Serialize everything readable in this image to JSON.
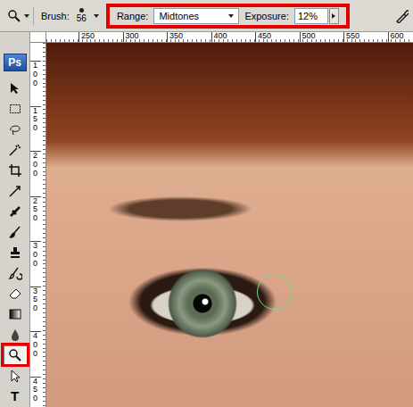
{
  "app_logo": "Ps",
  "options_bar": {
    "brush_label": "Brush:",
    "brush_size": "56",
    "range_label": "Range:",
    "range_value": "Midtones",
    "exposure_label": "Exposure:",
    "exposure_value": "12%",
    "highlighted": true
  },
  "tools": [
    {
      "selected": false,
      "highlighted": false
    },
    {
      "selected": false,
      "highlighted": false
    },
    {
      "selected": false,
      "highlighted": false
    },
    {
      "selected": false,
      "highlighted": false
    },
    {
      "selected": false,
      "highlighted": false
    },
    {
      "selected": false,
      "highlighted": false
    },
    {
      "selected": false,
      "highlighted": false
    },
    {
      "selected": false,
      "highlighted": false
    },
    {
      "selected": false,
      "highlighted": false
    },
    {
      "selected": false,
      "highlighted": false
    },
    {
      "selected": false,
      "highlighted": false
    },
    {
      "selected": false,
      "highlighted": false
    },
    {
      "selected": false,
      "highlighted": false
    },
    {
      "selected": true,
      "highlighted": true
    },
    {
      "selected": false,
      "highlighted": false
    },
    {
      "label": "T",
      "selected": false,
      "highlighted": false
    }
  ],
  "rulers": {
    "top": [
      "250",
      "300",
      "350",
      "400",
      "450",
      "500",
      "550",
      "600"
    ],
    "left": [
      "100",
      "150",
      "200",
      "250",
      "300",
      "350",
      "400",
      "450"
    ]
  },
  "canvas": {
    "brush_cursor_visible": true
  }
}
